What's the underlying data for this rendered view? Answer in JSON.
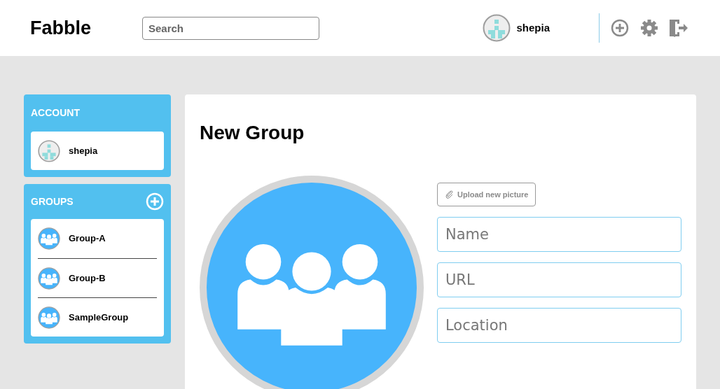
{
  "header": {
    "logo": "Fabble",
    "search": {
      "placeholder": "Search"
    },
    "user": "shepia"
  },
  "sidebar": {
    "account": {
      "title": "ACCOUNT",
      "user": "shepia"
    },
    "groups": {
      "title": "GROUPS",
      "items": [
        {
          "name": "Group-A"
        },
        {
          "name": "Group-B"
        },
        {
          "name": "SampleGroup"
        }
      ]
    }
  },
  "main": {
    "title": "New Group",
    "upload_button": "Upload new picture",
    "fields": [
      {
        "placeholder": "Name"
      },
      {
        "placeholder": "URL"
      },
      {
        "placeholder": "Location"
      }
    ]
  }
}
